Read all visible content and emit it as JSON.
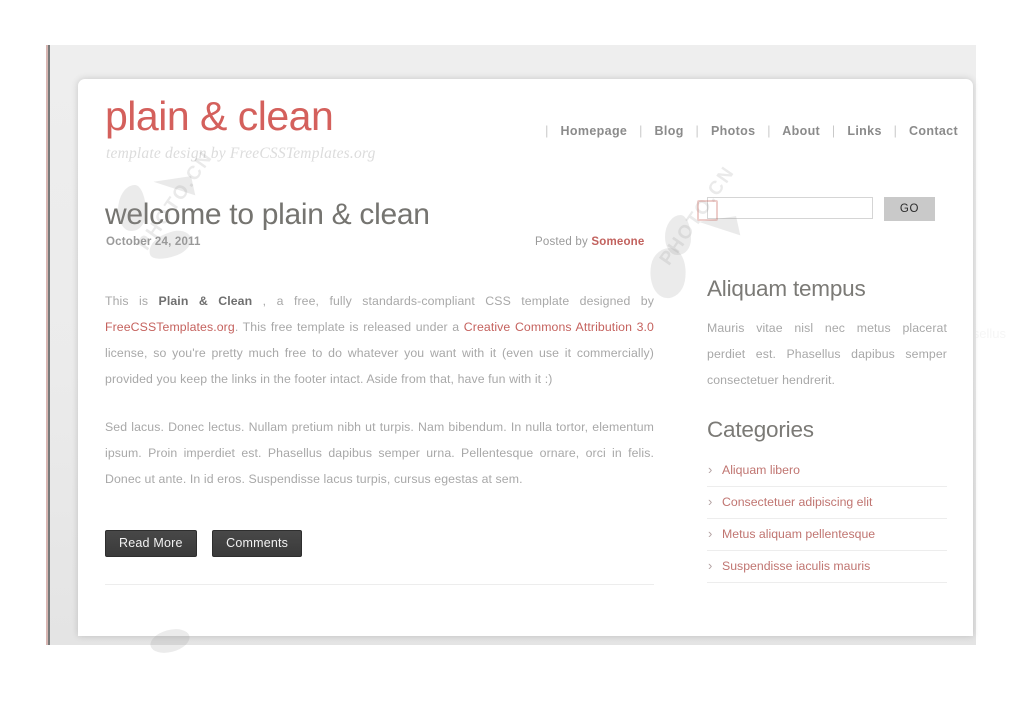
{
  "site": {
    "logo": "plain & clean",
    "tagline": "template design by FreeCSSTemplates.org"
  },
  "nav": {
    "separator": "|",
    "items": [
      {
        "label": "Homepage"
      },
      {
        "label": "Blog"
      },
      {
        "label": "Photos"
      },
      {
        "label": "About"
      },
      {
        "label": "Links"
      },
      {
        "label": "Contact"
      }
    ]
  },
  "post": {
    "title": "welcome to plain & clean",
    "date": "October 24, 2011",
    "posted_by_prefix": "Posted by ",
    "author": "Someone",
    "paragraph1": {
      "seg1": "This is ",
      "bold1": "Plain & Clean",
      "seg2": " , a free, fully standards-compliant CSS template designed by ",
      "link1": "FreeCSSTemplates.org",
      "seg3": ". This free template is released under a ",
      "link2": "Creative Commons Attribution 3.0",
      "seg4": " license, so you're pretty much free to do whatever you want with it (even use it commercially) provided you keep the links in the footer intact. Aside from that, have fun with it :)"
    },
    "paragraph2": "Sed lacus. Donec lectus. Nullam pretium nibh ut turpis. Nam bibendum. In nulla tortor, elementum ipsum. Proin imperdiet est. Phasellus dapibus semper urna. Pellentesque ornare, orci in felis. Donec ut ante. In id eros. Suspendisse lacus turpis, cursus egestas at sem.",
    "read_more_label": "Read More",
    "comments_label": "Comments"
  },
  "sidebar": {
    "search": {
      "value": "",
      "placeholder": "",
      "go_label": "GO"
    },
    "about": {
      "heading": "Aliquam tempus",
      "body": "Mauris vitae nisl nec metus placerat perdiet est. Phasellus dapibus semper consectetuer hendrerit."
    },
    "categories": {
      "heading": "Categories",
      "items": [
        {
          "label": "Aliquam libero"
        },
        {
          "label": "Consectetuer adipiscing elit"
        },
        {
          "label": "Metus aliquam pellentesque"
        },
        {
          "label": "Suspendisse iaculis mauris"
        }
      ]
    }
  },
  "ghost": {
    "nav_fragment": "Conta",
    "go_label": "GO",
    "body_fragment": "metus placerat perdiet est. Phasellus dapibus semper consectetuer",
    "category_fragment": "Suspendisse iaculis mauris"
  },
  "watermark": {
    "text": "PHOTO.CN"
  },
  "colors": {
    "logo_red": "#d4605c",
    "link_red": "#c5625e",
    "body_gray": "#a8a8a8",
    "heading_gray": "#7b7a76",
    "button_dark": "#3f3f3f",
    "go_gray": "#c9c9c9"
  }
}
